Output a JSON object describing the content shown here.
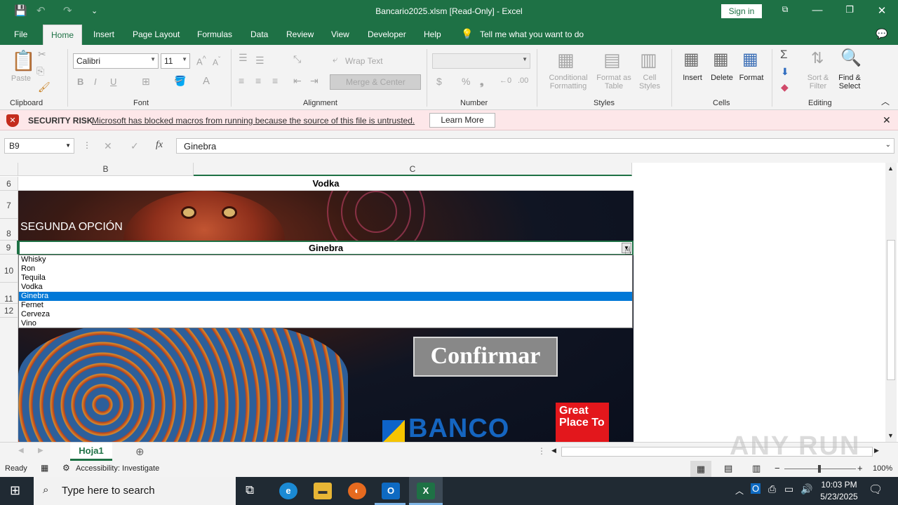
{
  "titlebar": {
    "title": "Bancario2025.xlsm  [Read-Only]  -  Excel",
    "signin": "Sign in",
    "qa_icons": [
      "save-icon",
      "undo-icon",
      "redo-icon",
      "customize-icon"
    ]
  },
  "tabs": [
    "File",
    "Home",
    "Insert",
    "Page Layout",
    "Formulas",
    "Data",
    "Review",
    "View",
    "Developer",
    "Help"
  ],
  "tell_me": "Tell me what you want to do",
  "ribbon": {
    "clipboard": {
      "label": "Clipboard",
      "paste": "Paste"
    },
    "font": {
      "label": "Font",
      "name": "Calibri",
      "size": "11"
    },
    "alignment": {
      "label": "Alignment",
      "wrap": "Wrap Text",
      "merge": "Merge & Center"
    },
    "number": {
      "label": "Number"
    },
    "styles": {
      "label": "Styles",
      "conditional": "Conditional",
      "formatting": "Formatting",
      "format_as": "Format as",
      "table": "Table",
      "cell": "Cell",
      "cell_styles": "Styles"
    },
    "cells": {
      "label": "Cells",
      "insert": "Insert",
      "delete": "Delete",
      "format": "Format"
    },
    "editing": {
      "label": "Editing",
      "sort": "Sort &",
      "filter": "Filter",
      "find": "Find &",
      "select": "Select"
    }
  },
  "security": {
    "title": "SECURITY RISK",
    "message": "Microsoft has blocked macros from running because the source of this file is untrusted.",
    "button": "Learn More"
  },
  "formula_bar": {
    "name_box": "B9",
    "fx": "fx",
    "value": "Ginebra"
  },
  "columns": [
    "B",
    "C"
  ],
  "rows": [
    "6",
    "7",
    "8",
    "9",
    "10",
    "11",
    "12"
  ],
  "cells": {
    "row6": "Vodka",
    "row9": "Ginebra"
  },
  "banner": {
    "segunda": "SEGUNDA OPCIÓN",
    "confirmar": "Confirmar",
    "banco": "BANCO",
    "gptw": "Great Place To"
  },
  "dropdown": {
    "items": [
      "Whisky",
      "Ron",
      "Tequila",
      "Vodka",
      "Ginebra",
      "Fernet",
      "Cerveza",
      "Vino"
    ],
    "selected": "Ginebra"
  },
  "sheet_tab": "Hoja1",
  "status": {
    "ready": "Ready",
    "accessibility": "Accessibility: Investigate",
    "zoom": "100%"
  },
  "taskbar": {
    "search_placeholder": "Type here to search",
    "time": "10:03 PM",
    "date": "5/23/2025"
  },
  "watermark": "ANY RUN"
}
